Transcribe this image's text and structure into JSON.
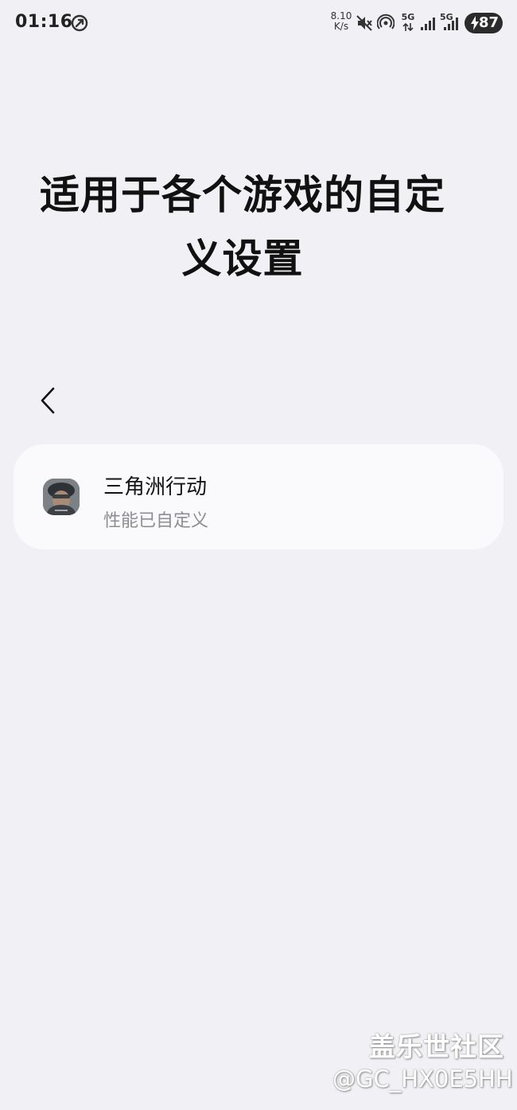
{
  "status_bar": {
    "time": "01:16",
    "net_speed_value": "8.10",
    "net_speed_unit": "K/s",
    "sim1_label": "5G",
    "sim2_label": "5G",
    "battery": "87"
  },
  "page": {
    "title": "适用于各个游戏的自定义设置"
  },
  "game_list": [
    {
      "name": "三角洲行动",
      "status": "性能已自定义"
    }
  ],
  "watermark": {
    "brand": "盖乐世社区",
    "user": "@GC_HX0E5HH"
  }
}
